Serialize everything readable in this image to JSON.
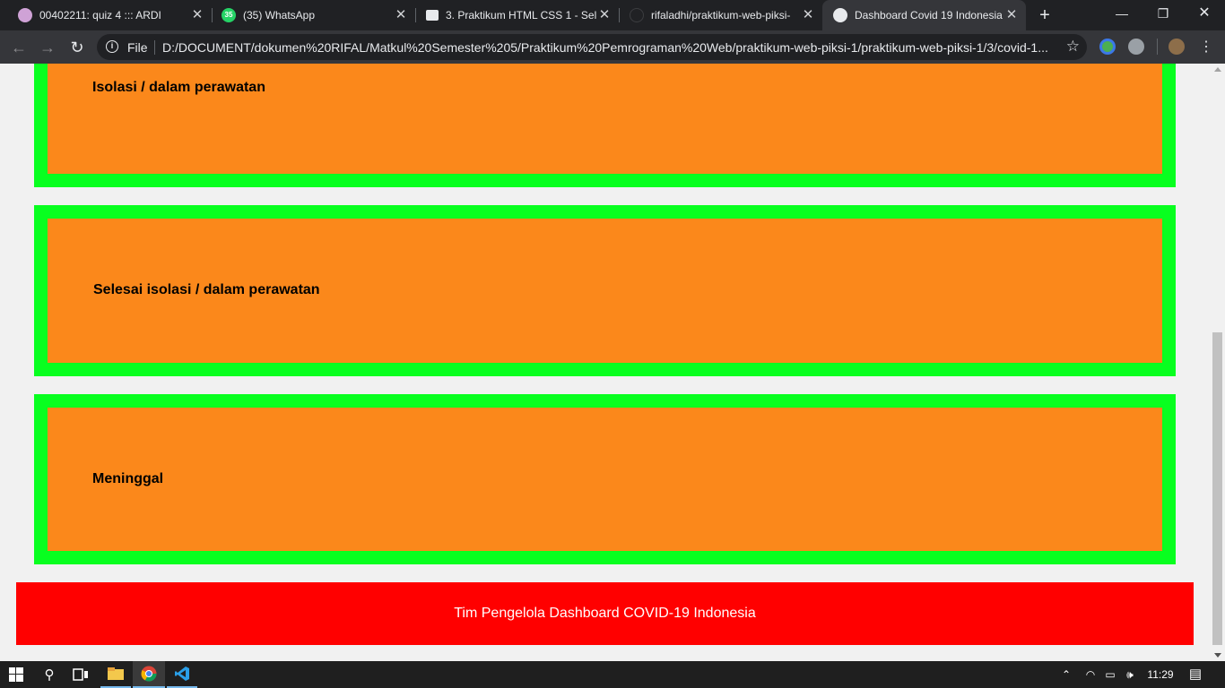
{
  "browser": {
    "tabs": [
      {
        "title": "00402211: quiz 4 ::: ARDI",
        "favicon": "moodle-icon"
      },
      {
        "title": "(35) WhatsApp",
        "favicon": "whatsapp-icon",
        "badge": "35"
      },
      {
        "title": "3. Praktikum HTML CSS 1 - Sel",
        "favicon": "classroom-icon"
      },
      {
        "title": "rifaladhi/praktikum-web-piksi-",
        "favicon": "github-icon"
      },
      {
        "title": "Dashboard Covid 19 Indonesia",
        "favicon": "globe-icon"
      }
    ],
    "active_tab": 4,
    "address": {
      "scheme_label": "File",
      "url": "D:/DOCUMENT/dokumen%20RIFAL/Matkul%20Semester%205/Praktikum%20Pemrograman%20Web/praktikum-web-piksi-1/praktikum-web-piksi-1/3/covid-1..."
    }
  },
  "page": {
    "cards": [
      {
        "label": "Isolasi / dalam perawatan"
      },
      {
        "label": "Selesai isolasi / dalam perawatan"
      },
      {
        "label": "Meninggal"
      }
    ],
    "footer_text": "Tim Pengelola Dashboard COVID-19 Indonesia"
  },
  "taskbar": {
    "clock": "11:29"
  },
  "colors": {
    "card_border": "#08ff1f",
    "card_fill": "#fb881b",
    "footer_bg": "#ff0000"
  }
}
